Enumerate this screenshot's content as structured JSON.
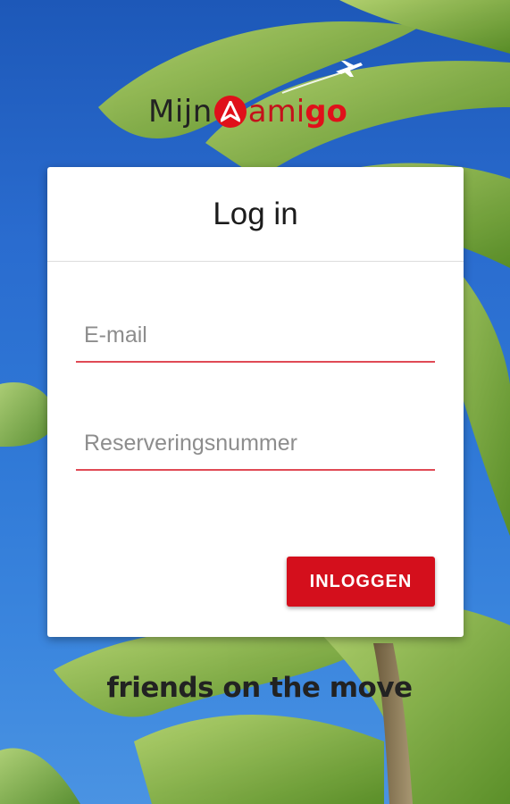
{
  "background": {
    "sky_color": "#2a6ccf",
    "palm_color": "#8cbf3a"
  },
  "logo": {
    "part_mijn": "Mijn",
    "part_am": "am",
    "part_i": "i",
    "part_go": "go",
    "brand_color": "#e0101a",
    "icon": "plane-icon"
  },
  "card": {
    "title": "Log in",
    "email": {
      "placeholder": "E-mail",
      "value": ""
    },
    "reservation": {
      "placeholder": "Reserveringsnummer",
      "value": ""
    },
    "login_button": "INLOGGEN",
    "accent_color": "#d40f1c"
  },
  "tagline": "friends on the move"
}
